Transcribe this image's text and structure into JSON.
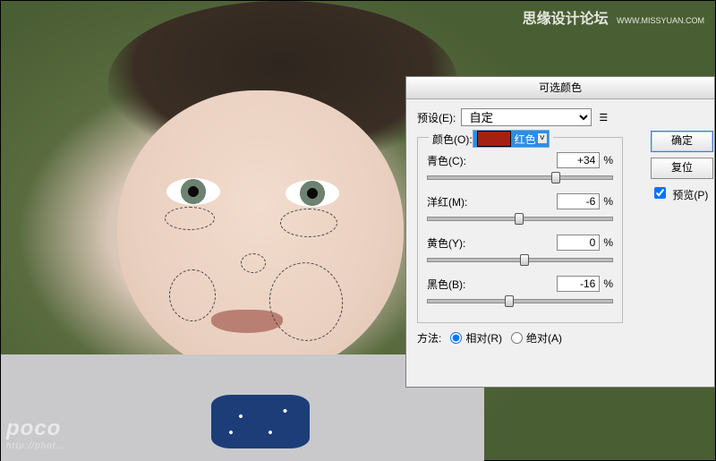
{
  "watermark_top": {
    "chinese": "思缘设计论坛",
    "url": "WWW.MISSYUAN.COM"
  },
  "watermark_bl": {
    "brand": "poco",
    "sub": "http://phot..."
  },
  "dialog": {
    "title": "可选颜色",
    "preset_label": "预设(E):",
    "preset_value": "自定",
    "ok": "确定",
    "reset": "复位",
    "preview": "预览(P)",
    "group": {
      "color_label": "颜色(O):",
      "color_value": "红色",
      "sliders": [
        {
          "label": "青色(C):",
          "value": "+34",
          "pos": 67
        },
        {
          "label": "洋红(M):",
          "value": "-6",
          "pos": 47
        },
        {
          "label": "黄色(Y):",
          "value": "0",
          "pos": 50
        },
        {
          "label": "黑色(B):",
          "value": "-16",
          "pos": 42
        }
      ]
    },
    "method": {
      "label": "方法:",
      "relative": "相对(R)",
      "absolute": "绝对(A)"
    }
  }
}
